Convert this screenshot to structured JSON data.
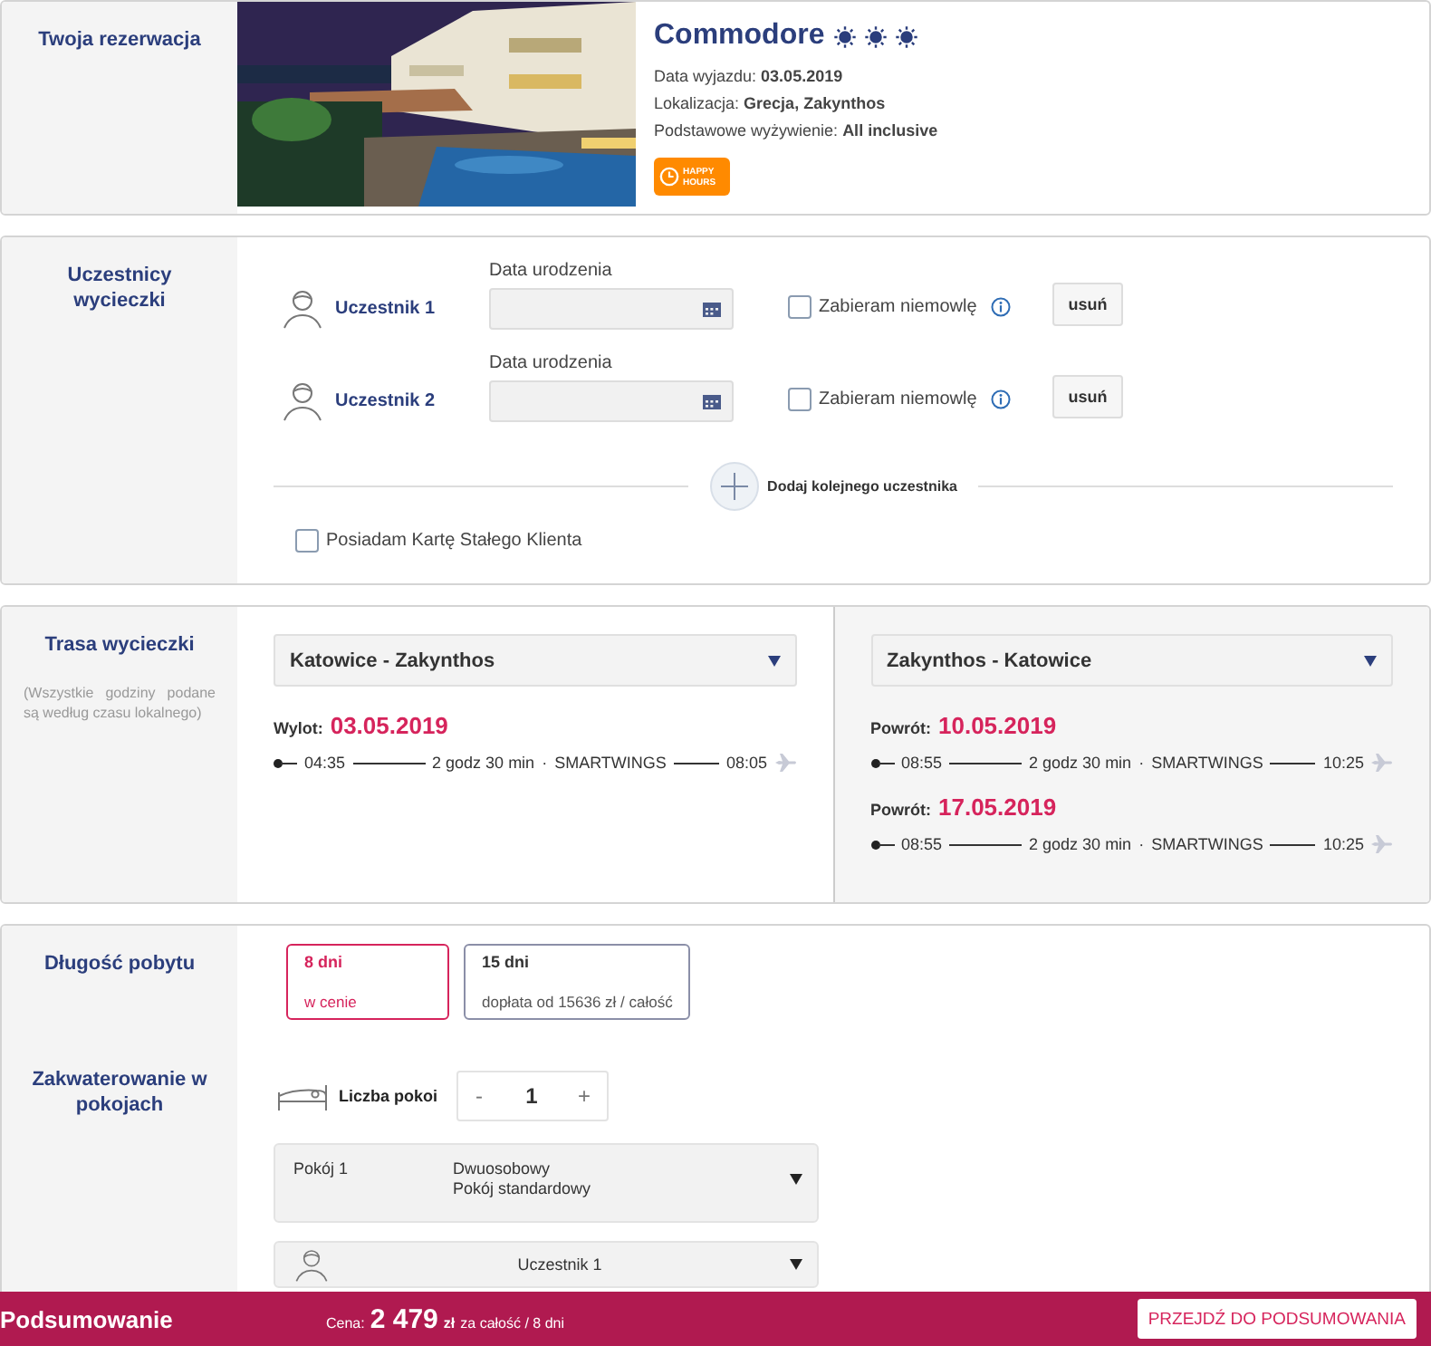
{
  "reservation": {
    "section_title": "Twoja rezerwacja",
    "hotel_name": "Commodore",
    "stars": 3,
    "details": [
      {
        "label": "Data wyjazdu:",
        "value": "03.05.2019"
      },
      {
        "label": "Lokalizacja:",
        "value": "Grecja, Zakynthos"
      },
      {
        "label": "Podstawowe wyżywienie:",
        "value": "All inclusive"
      }
    ],
    "badge_lines": [
      "HAPPY",
      "HOURS"
    ]
  },
  "participants": {
    "section_title": "Uczestnicy wycieczki",
    "people": [
      {
        "name": "Uczestnik 1",
        "date_label": "Data urodzenia",
        "infant_label": "Zabieram niemowlę",
        "infant_checked": false,
        "remove_label": "usuń"
      },
      {
        "name": "Uczestnik 2",
        "date_label": "Data urodzenia",
        "infant_label": "Zabieram niemowlę",
        "infant_checked": false,
        "remove_label": "usuń"
      }
    ],
    "add_label": "Dodaj kolejnego uczestnika",
    "loyalty": {
      "label": "Posiadam Kartę Stałego Klienta",
      "checked": false
    }
  },
  "route": {
    "section_title": "Trasa wycieczki",
    "note": "(Wszystkie godziny podane są według czasu lokalnego)",
    "columns": [
      {
        "route": "Katowice - Zakynthos",
        "legs": [
          {
            "label": "Wylot:",
            "date": "03.05.2019",
            "departure": "04:35",
            "duration": "2 godz 30 min",
            "separator": "·",
            "carrier": "SMARTWINGS",
            "arrival": "08:05"
          }
        ]
      },
      {
        "route": "Zakynthos - Katowice",
        "legs": [
          {
            "label": "Powrót:",
            "date": "10.05.2019",
            "departure": "08:55",
            "duration": "2 godz 30 min",
            "separator": "·",
            "carrier": "SMARTWINGS",
            "arrival": "10:25"
          },
          {
            "label": "Powrót:",
            "date": "17.05.2019",
            "departure": "08:55",
            "duration": "2 godz 30 min",
            "separator": "·",
            "carrier": "SMARTWINGS",
            "arrival": "10:25"
          }
        ]
      }
    ]
  },
  "stay": {
    "section_title": "Długość pobytu",
    "options": [
      {
        "title": "8 dni",
        "subtitle": "w cenie",
        "selected": true
      },
      {
        "title": "15 dni",
        "subtitle": "dopłata od 15636 zł / całość",
        "selected": false
      }
    ]
  },
  "accommodation": {
    "section_title": "Zakwaterowanie w pokojach",
    "rooms_label": "Liczba pokoi",
    "minus": "-",
    "count": "1",
    "plus": "+",
    "room": {
      "label": "Pokój 1",
      "type_lines": [
        "Dwuosobowy",
        "Pokój standardowy"
      ]
    },
    "occupants": [
      {
        "name": "Uczestnik 1"
      }
    ]
  },
  "footer": {
    "title": "Podsumowanie",
    "price_label": "Cena:",
    "price": "2 479",
    "currency": "zł",
    "price_note": "za całość / 8 dni",
    "button": "PRZEJDŹ DO PODSUMOWANIA"
  }
}
